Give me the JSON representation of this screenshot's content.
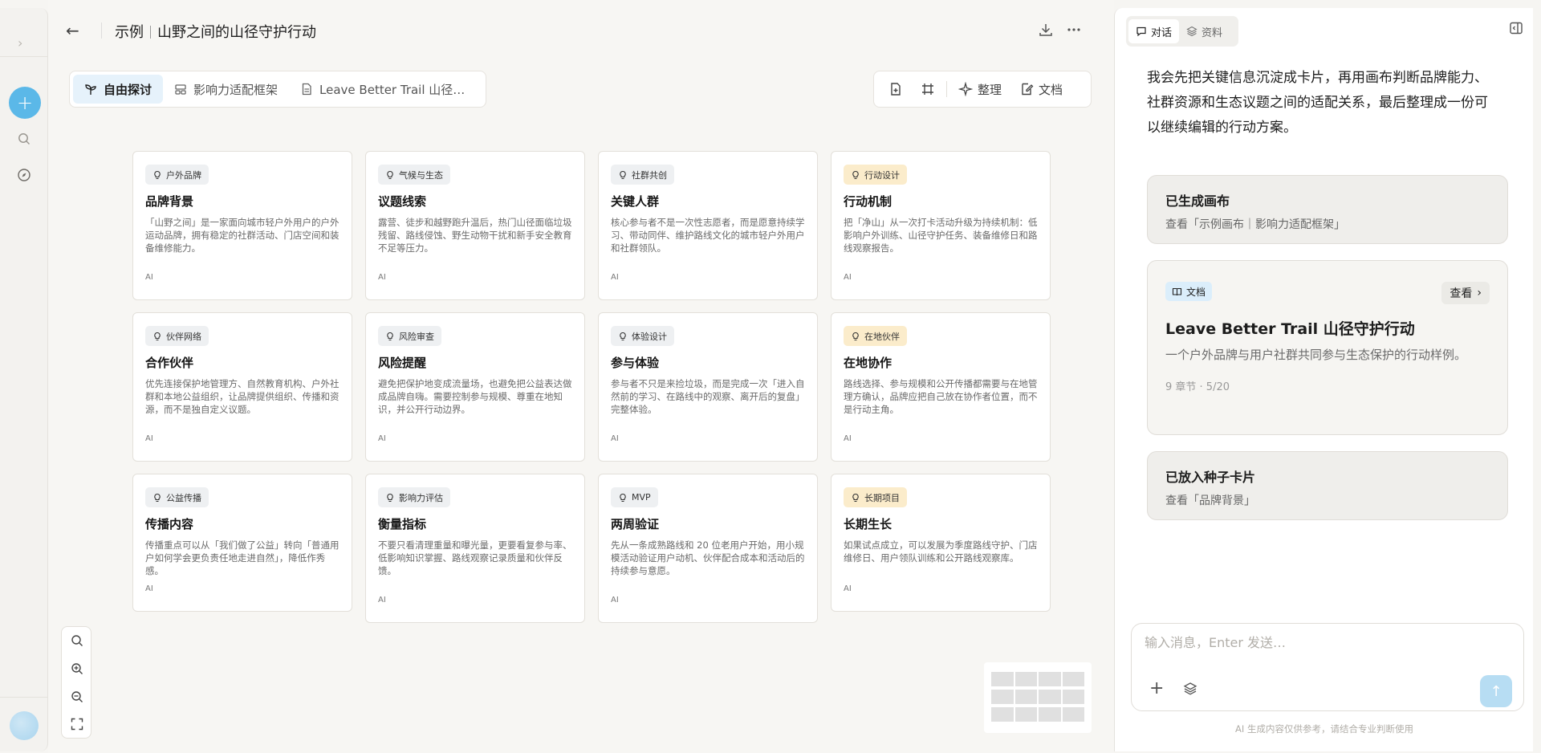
{
  "header": {
    "breadcrumb_parent": "示例",
    "title": "山野之间的山径守护行动"
  },
  "tabs": [
    {
      "label": "自由探讨",
      "icon": "sprout-icon"
    },
    {
      "label": "影响力适配框架",
      "icon": "layout-icon"
    },
    {
      "label": "Leave Better Trail 山径…",
      "icon": "document-icon"
    }
  ],
  "tools": {
    "organize_label": "整理",
    "doc_label": "文档"
  },
  "cards": [
    {
      "tag": "户外品牌",
      "tag_style": "gray",
      "title": "品牌背景",
      "body": "「山野之间」是一家面向城市轻户外用户的户外运动品牌，拥有稳定的社群活动、门店空间和装备维修能力。",
      "ai": "AI"
    },
    {
      "tag": "气候与生态",
      "tag_style": "gray",
      "title": "议题线索",
      "body": "露营、徒步和越野跑升温后，热门山径面临垃圾残留、路线侵蚀、野生动物干扰和新手安全教育不足等压力。",
      "ai": "AI"
    },
    {
      "tag": "社群共创",
      "tag_style": "gray",
      "title": "关键人群",
      "body": "核心参与者不是一次性志愿者，而是愿意持续学习、带动同伴、维护路线文化的城市轻户外用户和社群领队。",
      "ai": "AI"
    },
    {
      "tag": "行动设计",
      "tag_style": "warm",
      "title": "行动机制",
      "body": "把「净山」从一次打卡活动升级为持续机制：低影响户外训练、山径守护任务、装备维修日和路线观察报告。",
      "ai": "AI"
    },
    {
      "tag": "伙伴网络",
      "tag_style": "gray",
      "title": "合作伙伴",
      "body": "优先连接保护地管理方、自然教育机构、户外社群和本地公益组织，让品牌提供组织、传播和资源，而不是独自定义议题。",
      "ai": "AI"
    },
    {
      "tag": "风险审查",
      "tag_style": "gray",
      "title": "风险提醒",
      "body": "避免把保护地变成流量场，也避免把公益表达做成品牌自嗨。需要控制参与规模、尊重在地知识，并公开行动边界。",
      "ai": "AI"
    },
    {
      "tag": "体验设计",
      "tag_style": "gray",
      "title": "参与体验",
      "body": "参与者不只是来捡垃圾，而是完成一次「进入自然前的学习、在路线中的观察、离开后的复盘」完整体验。",
      "ai": "AI"
    },
    {
      "tag": "在地伙伴",
      "tag_style": "warm",
      "title": "在地协作",
      "body": "路线选择、参与规模和公开传播都需要与在地管理方确认，品牌应把自己放在协作者位置，而不是行动主角。",
      "ai": "AI"
    },
    {
      "tag": "公益传播",
      "tag_style": "gray",
      "title": "传播内容",
      "body": "传播重点可以从「我们做了公益」转向「普通用户如何学会更负责任地走进自然」，降低作秀感。",
      "ai": "AI"
    },
    {
      "tag": "影响力评估",
      "tag_style": "gray",
      "title": "衡量指标",
      "body": "不要只看清理重量和曝光量，更要看复参与率、低影响知识掌握、路线观察记录质量和伙伴反馈。",
      "ai": "AI"
    },
    {
      "tag": "MVP",
      "tag_style": "gray",
      "title": "两周验证",
      "body": "先从一条成熟路线和 20 位老用户开始，用小规模活动验证用户动机、伙伴配合成本和活动后的持续参与意愿。",
      "ai": "AI"
    },
    {
      "tag": "长期项目",
      "tag_style": "warm",
      "title": "长期生长",
      "body": "如果试点成立，可以发展为季度路线守护、门店维修日、用户领队训练和公开路线观察库。",
      "ai": "AI"
    }
  ],
  "panel": {
    "tab_chat": "对话",
    "tab_materials": "资料",
    "message": "我会先把关键信息沉淀成卡片，再用画布判断品牌能力、社群资源和生态议题之间的适配关系，最后整理成一份可以继续编辑的行动方案。",
    "canvas_block": {
      "title": "已生成画布",
      "sub": "查看「示例画布｜影响力适配框架」"
    },
    "doc_block": {
      "chip": "文档",
      "view_label": "查看",
      "title": "Leave Better Trail 山径守护行动",
      "desc": "一个户外品牌与用户社群共同参与生态保护的行动样例。",
      "meta": "9 章节 · 5/20"
    },
    "seed_block": {
      "title": "已放入种子卡片",
      "sub": "查看「品牌背景」"
    },
    "input_placeholder": "输入消息，Enter 发送…",
    "footnote": "AI 生成内容仅供参考，请结合专业判断使用"
  }
}
